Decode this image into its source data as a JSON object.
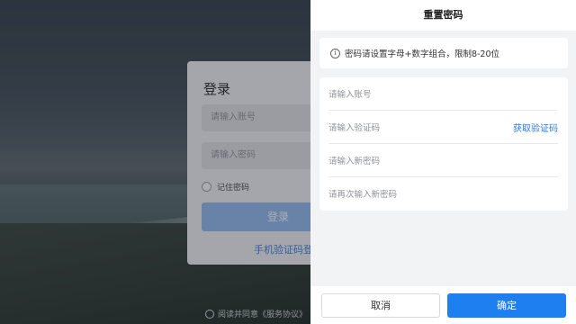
{
  "login": {
    "title": "登录",
    "account_placeholder": "请输入账号",
    "password_placeholder": "请输入密码",
    "remember_label": "记住密码",
    "login_button": "登录",
    "sms_login_link": "手机验证码登",
    "agreement_text": "阅读并同意《服务协议》"
  },
  "reset_drawer": {
    "title": "重置密码",
    "tip": "密码请设置字母+数字组合，限制8-20位",
    "fields": {
      "account_placeholder": "请输入账号",
      "code_placeholder": "请输入验证码",
      "get_code": "获取验证码",
      "new_password_placeholder": "请输入新密码",
      "confirm_password_placeholder": "请再次输入新密码"
    },
    "cancel_button": "取消",
    "confirm_button": "确定"
  },
  "colors": {
    "primary": "#1e7ff0",
    "link": "#2d7be0",
    "login_button_disabled": "#8db3e6"
  },
  "icons": {
    "tip_icon": "info-circle-icon"
  }
}
